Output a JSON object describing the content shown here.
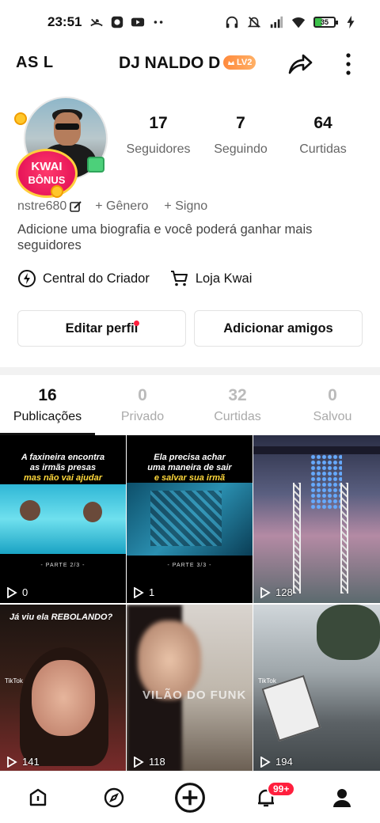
{
  "status_bar": {
    "time": "23:51",
    "icons": [
      "missed-call-icon",
      "app-icon",
      "youtube-icon",
      "more-dots-icon",
      "headphones-icon",
      "mute-icon",
      "signal-icon",
      "wifi-icon",
      "battery-icon",
      "charging-icon"
    ],
    "battery_level": "35"
  },
  "header": {
    "left_name": "AS L",
    "title": "DJ NALDO D",
    "level_badge": "LV2"
  },
  "profile": {
    "avatar_badge_line1": "KWAI",
    "avatar_badge_line2": "BÔNUS",
    "stats": [
      {
        "value": "17",
        "label": "Seguidores"
      },
      {
        "value": "7",
        "label": "Seguindo"
      },
      {
        "value": "64",
        "label": "Curtidas"
      }
    ],
    "user_id": "nstre680",
    "gender_chip": "+ Gênero",
    "sign_chip": "+ Signo",
    "bio": "Adicione uma biografia e você poderá ganhar mais seguidores",
    "creator_center": "Central do Criador",
    "kwai_shop": "Loja Kwai",
    "edit_profile": "Editar perfil",
    "add_friends": "Adicionar amigos"
  },
  "tabs": [
    {
      "count": "16",
      "label": "Publicações",
      "active": true
    },
    {
      "count": "0",
      "label": "Privado",
      "active": false
    },
    {
      "count": "32",
      "label": "Curtidas",
      "active": false
    },
    {
      "count": "0",
      "label": "Salvou",
      "active": false
    }
  ],
  "posts": [
    {
      "views": "0",
      "caption_line1": "A faxineira encontra",
      "caption_line2": "as irmãs presas",
      "caption_line3": "mas não vai ajudar",
      "part": "- PARTE 2/3 -"
    },
    {
      "views": "1",
      "caption_line1": "Ela precisa achar",
      "caption_line2": "uma maneira de sair",
      "caption_line3": "e salvar sua irmã",
      "part": "- PARTE 3/3 -"
    },
    {
      "views": "128"
    },
    {
      "views": "141",
      "caption_line1": "Já viu ela REBOLANDO?",
      "tiktok": "TikTok"
    },
    {
      "views": "118",
      "watermark": "VILÃO DO FUNK"
    },
    {
      "views": "194",
      "tiktok": "TikTok"
    }
  ],
  "bottom_nav": {
    "items": [
      "home-icon",
      "discover-icon",
      "create-icon",
      "notifications-icon",
      "profile-icon"
    ],
    "notifications_badge": "99+"
  }
}
